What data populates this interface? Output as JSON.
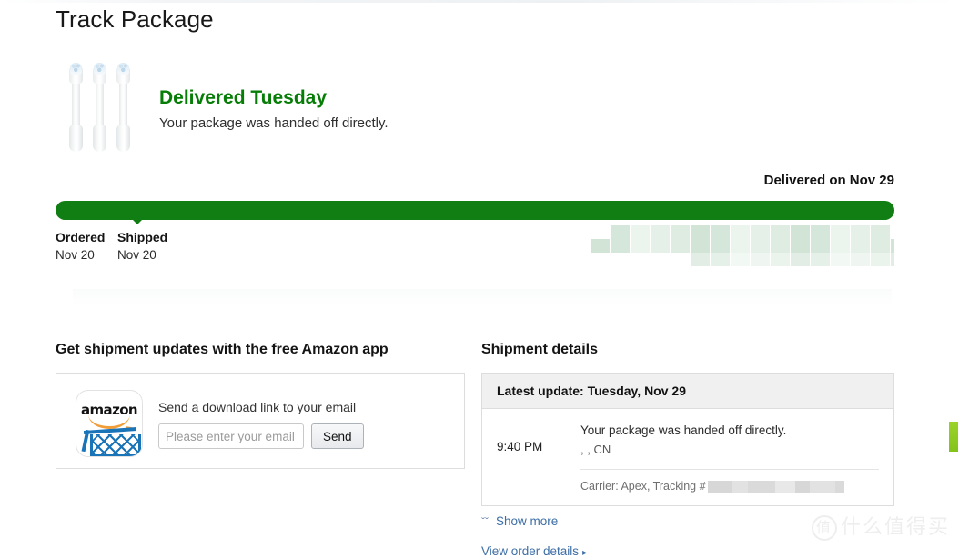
{
  "page": {
    "title": "Track Package"
  },
  "status": {
    "headline": "Delivered Tuesday",
    "subtext": "Your package was handed off directly.",
    "product_image_alt": "toothbrush-heads"
  },
  "tracker": {
    "delivered_on": "Delivered on Nov 29",
    "progress_percent": 100,
    "milestones": [
      {
        "label": "Ordered",
        "date": "Nov 20"
      },
      {
        "label": "Shipped",
        "date": "Nov 20"
      }
    ]
  },
  "app_promo": {
    "title": "Get shipment updates with the free Amazon app",
    "icon_wordmark": "amazon",
    "form_label": "Send a download link to your email",
    "email_placeholder": "Please enter your email",
    "email_value": "",
    "send_label": "Send"
  },
  "shipment": {
    "title": "Shipment details",
    "latest_update": "Latest update: Tuesday, Nov 29",
    "event": {
      "time": "9:40 PM",
      "description": "Your package was handed off directly.",
      "location": ", , CN"
    },
    "carrier_line": "Carrier: Apex, Tracking #",
    "show_more": "Show more",
    "view_order_details": "View order details",
    "arrow_glyph": "▸",
    "chevron_glyph": "ˇˇ"
  },
  "watermark": {
    "mark": "值",
    "text": "什么值得买"
  },
  "colors": {
    "progress_green": "#117e13",
    "status_green": "#067d06",
    "link_blue": "#3d6ea5",
    "panel_header_gray": "#f0f0f0",
    "edge_tab_green": "#8ec31f"
  }
}
